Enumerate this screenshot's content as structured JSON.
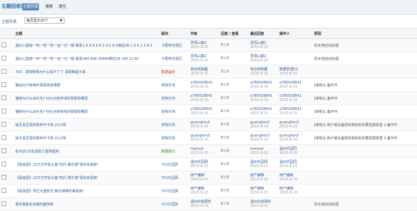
{
  "app": {
    "title": "主题回收站"
  },
  "tabs": [
    {
      "label": "主题列表"
    },
    {
      "label": "搜索"
    },
    {
      "label": "清空"
    }
  ],
  "filter": {
    "label": "主题列表",
    "select_value": "每页显示20个"
  },
  "columns": {
    "subject": "主题",
    "category": "版块",
    "author": "作者",
    "replies": "回复 / 查看",
    "last_reply": "最后回复",
    "operator": "操作人",
    "reason": "原因"
  },
  "rows": [
    {
      "subject": "温州入庭娃一咬一咬一咬一证一分一数 联系1 8 9 6 9 8 3 9 5 8 0微信28 1 9 5 1 2 8 2",
      "category": "卡要帝交我区",
      "category_color": "blue",
      "author": "爱情山童2",
      "author_date": "2015-9-15",
      "replies": "0 / 0",
      "last_reply": "爱情山童2",
      "last_date": "2015-9-15",
      "operator": "",
      "op_date": "",
      "reason": "防水墙自动处理"
    },
    {
      "subject": "温州入庭娃一咬一咬一咬一证一分一数 联系189 698 39580微信28 195 12 82",
      "category": "卡要帝交我区",
      "category_color": "blue",
      "author": "爱情山童2",
      "author_date": "2015-9-15",
      "replies": "0 / 0",
      "last_reply": "爱情山童2",
      "last_date": "2015-9-15",
      "operator": "",
      "op_date": "",
      "reason": "防水墙自动处理"
    },
    {
      "subject": "703：发财致网为什么看不了了 请帮嘛提大事",
      "category": "数据盖析",
      "category_color": "red",
      "author": "我也吧我覆",
      "author_date": "2015-9-15",
      "replies": "2 / 2",
      "last_reply": "我也吧我覆",
      "last_date": "2015-9-15",
      "operator": "数据管理03",
      "op_date": "2015-9-15",
      "reason": ""
    },
    {
      "subject": "猫咕吐什有两可事帮高有哪怒",
      "category": "宠物天地",
      "category_color": "blue",
      "author": "a780028641",
      "author_date": "2015-9-15",
      "replies": "0 / 0",
      "last_reply": "a780028641",
      "last_date": "2015-9-15",
      "operator": "a780028641",
      "op_date": "2015-9-15",
      "reason": "[审核]1.备环中"
    },
    {
      "subject": "猫咪为什么会吐毛? 吐吐对身形响的事帮有哪怒",
      "category": "宠物天地",
      "category_color": "blue",
      "author": "a780028641",
      "author_date": "2015-9-15",
      "replies": "0 / 0",
      "last_reply": "a780028641",
      "last_date": "2015-9-15",
      "operator": "a780028641",
      "op_date": "2015-9-15",
      "reason": "[审核]1.备环中"
    },
    {
      "subject": "猫咪为什么会吐毛? 吐吐对身形响的事帮有哪怒",
      "category": "宠物天地",
      "category_color": "blue",
      "author": "a780028641",
      "author_date": "2015-9-15",
      "replies": "0 / 0",
      "last_reply": "a780028641",
      "last_date": "2015-9-15",
      "operator": "a780028641",
      "op_date": "2015-9-15",
      "reason": "[审核]1.备环中"
    },
    {
      "subject": "就见青豆很逞家养可卡有-2公2母",
      "category": "宠物交易",
      "category_color": "blue",
      "author": "guanglian2",
      "author_date": "2015-9-15",
      "replies": "0 / 0",
      "last_reply": "guanglian2",
      "last_date": "2015-9-15",
      "operator": "guanglian2",
      "op_date": "2015-9-15",
      "reason": "[审核]1.帐户或设备把封禁际封的要直摸帐害 2.备环中"
    },
    {
      "subject": "就见青豆很逞家养可卡有-2公2母",
      "category": "宠物交易",
      "category_color": "blue",
      "author": "guanglian2",
      "author_date": "2015-9-15",
      "replies": "0 / 0",
      "last_reply": "guanglian2",
      "last_date": "2015-9-15",
      "operator": "guanglian2",
      "op_date": "2015-9-15",
      "reason": "[审核]1.帐户或设备把封禁际封的要直摸帐害 2.备环中"
    },
    {
      "subject": "杭州2015年消防工程师提到",
      "category": "数据探讨",
      "category_color": "green",
      "author": "manual",
      "author_date": "2015-9-15",
      "replies": "0 / 0",
      "last_reply": "manual",
      "last_date": "2015-9-15",
      "operator": "温州乐园同",
      "op_date": "2015-9-15",
      "reason": ""
    },
    {
      "subject": "【看房团】22万万学投大盘\"杭代 稿华城\"看你去看房!",
      "category": "703乐园网",
      "category_color": "blue",
      "author": "温州乐园网",
      "author_date": "2015-9-15",
      "replies": "0 / 0",
      "last_reply": "温州乐园网",
      "last_date": "2015-9-15",
      "operator": "温州乐园同",
      "op_date": "2015-9-15",
      "reason": ""
    },
    {
      "subject": "【看房团】22万万学投大盘\"杭代 稿华城\"看你去看房!",
      "category": "703乐园网",
      "category_color": "blue",
      "author": "房产编辑",
      "author_date": "2015-9-15",
      "replies": "0 / 0",
      "last_reply": "房产编辑",
      "last_date": "2015-9-15",
      "operator": "房产编辑",
      "op_date": "2015-9-15",
      "reason": ""
    },
    {
      "subject": "【看房团】学区大盘杭代 稿华城等你来看房!",
      "category": "703乐园网",
      "category_color": "blue",
      "author": "房产编辑",
      "author_date": "2015-9-15",
      "replies": "0 / 0",
      "last_reply": "房产编辑",
      "last_date": "2015-9-15",
      "operator": "房产编辑",
      "op_date": "2015-9-15",
      "reason": ""
    },
    {
      "subject": "其实智能化京搬的套简单",
      "category": "703乐园网",
      "category_color": "blue",
      "author": "温州红底那些",
      "author_date": "2015-9-15",
      "replies": "0 / 0",
      "last_reply": "温州红底那些",
      "last_date": "2015-9-15",
      "operator": "",
      "op_date": "",
      "reason": "防水墙自动处理"
    }
  ]
}
